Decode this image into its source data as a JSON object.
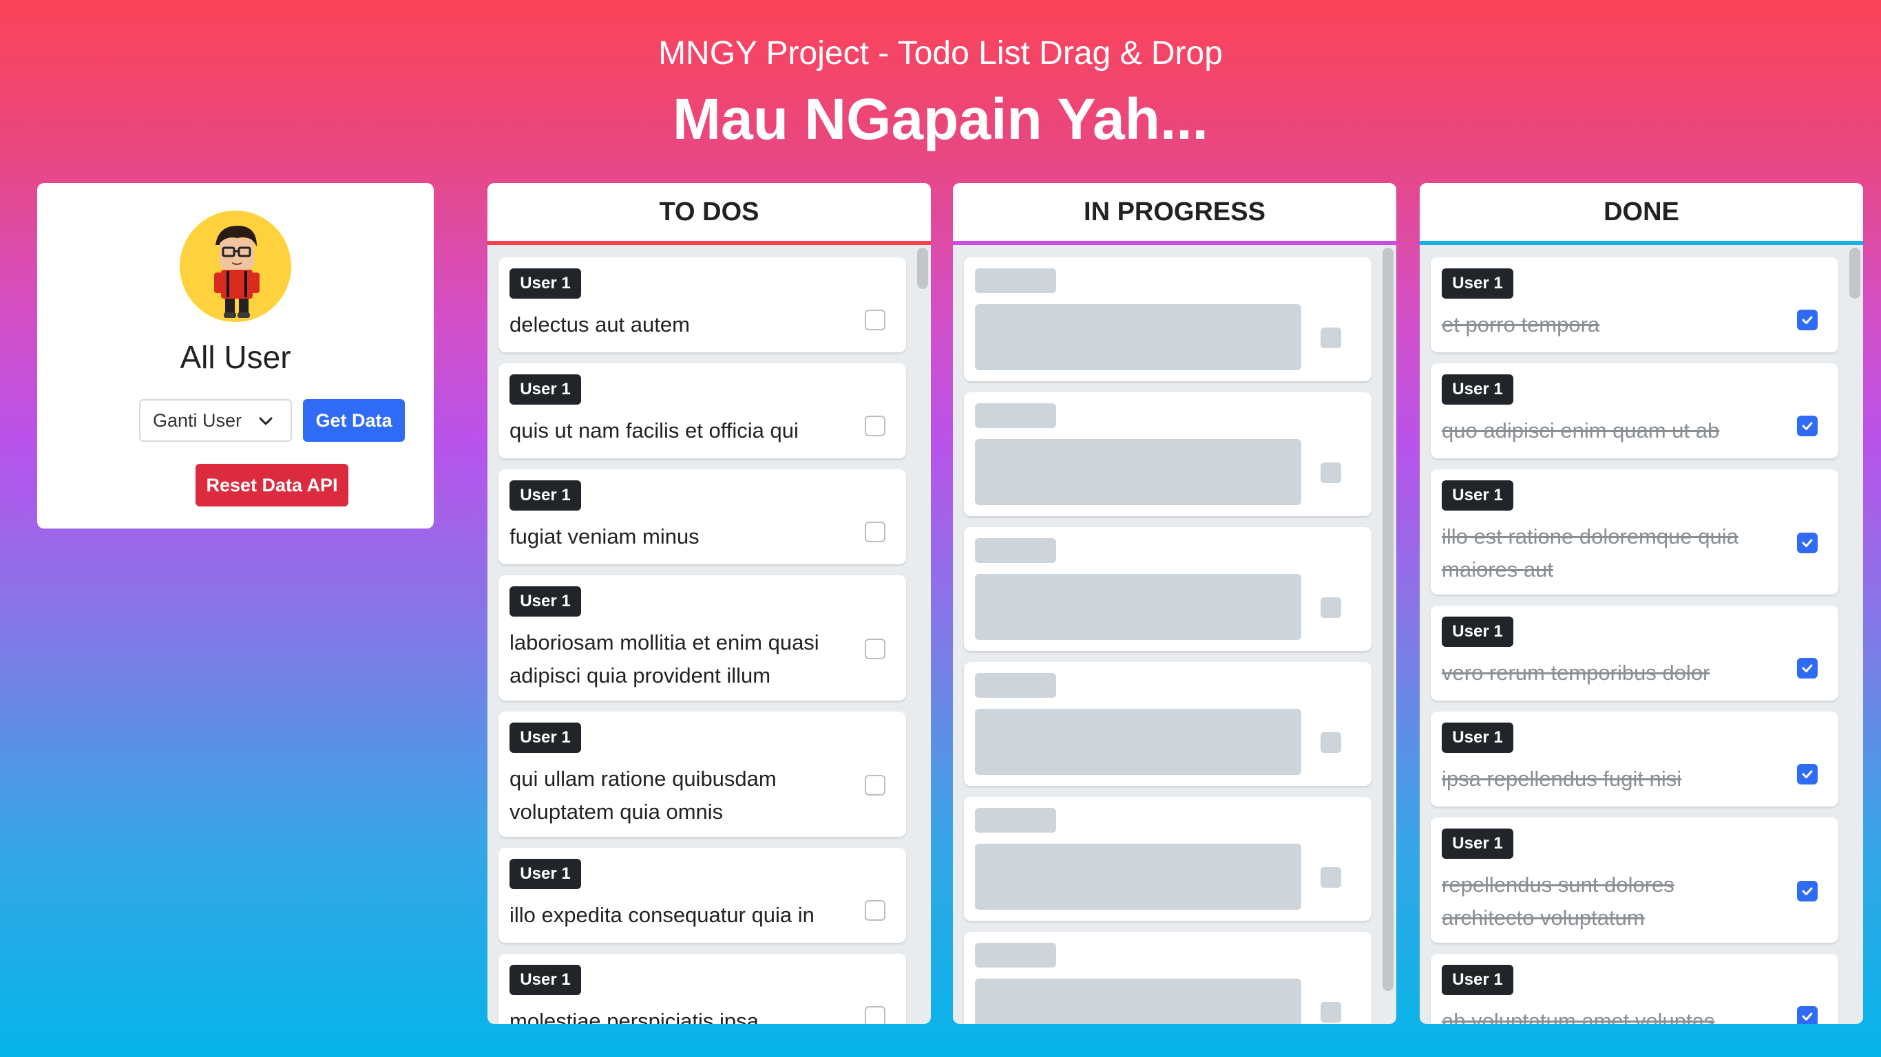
{
  "header": {
    "subtitle": "MNGY Project - Todo List Drag & Drop",
    "title": "Mau NGapain Yah..."
  },
  "user_panel": {
    "name": "All User",
    "select_value": "Ganti User",
    "get_button": "Get Data",
    "reset_button": "Reset Data API"
  },
  "colors": {
    "todo_accent": "#f8414e",
    "progress_accent": "#c94de0",
    "done_accent": "#13b3e6",
    "primary": "#2f6bf5",
    "danger": "#dc2b3e"
  },
  "columns": {
    "todo": {
      "title": "TO DOS",
      "cards": [
        {
          "badge": "User 1",
          "text": "delectus aut autem",
          "checked": false
        },
        {
          "badge": "User 1",
          "text": "quis ut nam facilis et officia qui",
          "checked": false
        },
        {
          "badge": "User 1",
          "text": "fugiat veniam minus",
          "checked": false
        },
        {
          "badge": "User 1",
          "text": "laboriosam mollitia et enim quasi adipisci quia provident illum",
          "checked": false
        },
        {
          "badge": "User 1",
          "text": "qui ullam ratione quibusdam voluptatem quia omnis",
          "checked": false
        },
        {
          "badge": "User 1",
          "text": "illo expedita consequatur quia in",
          "checked": false
        },
        {
          "badge": "User 1",
          "text": "molestiae perspiciatis ipsa",
          "checked": false
        }
      ]
    },
    "progress": {
      "title": "IN PROGRESS",
      "state": "loading"
    },
    "done": {
      "title": "DONE",
      "cards": [
        {
          "badge": "User 1",
          "text": "et porro tempora",
          "checked": true
        },
        {
          "badge": "User 1",
          "text": "quo adipisci enim quam ut ab",
          "checked": true
        },
        {
          "badge": "User 1",
          "text": "illo est ratione doloremque quia maiores aut",
          "checked": true
        },
        {
          "badge": "User 1",
          "text": "vero rerum temporibus dolor",
          "checked": true
        },
        {
          "badge": "User 1",
          "text": "ipsa repellendus fugit nisi",
          "checked": true
        },
        {
          "badge": "User 1",
          "text": "repellendus sunt dolores architecto voluptatum",
          "checked": true
        },
        {
          "badge": "User 1",
          "text": "ab voluptatum amet voluptas",
          "checked": true
        }
      ]
    }
  }
}
